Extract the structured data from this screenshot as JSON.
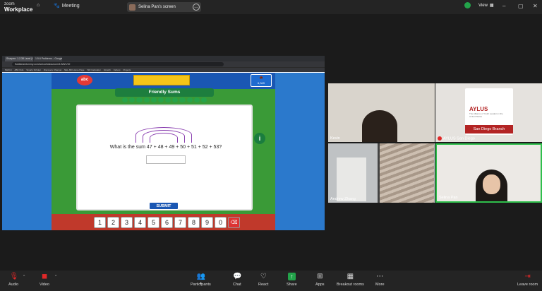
{
  "zoom": {
    "brand_top": "zoom",
    "brand_bottom": "Workplace",
    "meeting_label": "Meeting",
    "screen_share_label": "Selina Pan's screen",
    "view_label": "View",
    "colors": {
      "accent_green": "#23a34a",
      "mic_red": "#e02828",
      "bar": "#242424"
    }
  },
  "browser": {
    "tabs": [
      "Sharpen: 1.2.38 Level | K-Sharpen",
      "1.5.6 Problems – Google Docs"
    ],
    "url": "fluidsteamtommy.com/school/classroom/1/3/6/1/10",
    "bookmarks": [
      "NHICH",
      "ABC Kids",
      "Smarty Scholar",
      "Discovery Channel",
      "SEL-ISD Home Page",
      "ISD Calculator",
      "Scratch",
      "Kahoot",
      "Projects"
    ]
  },
  "game": {
    "logo": "abc",
    "title": "Friendly Sums",
    "acorn_count": "6,349",
    "question": "What is the sum 47 + 48 + 49 + 50 + 51 + 52 + 53?",
    "answer_value": "",
    "submit_label": "SUBMIT",
    "info_glyph": "i",
    "keypad": [
      "1",
      "2",
      "3",
      "4",
      "5",
      "6",
      "7",
      "8",
      "9",
      "0"
    ],
    "delete_glyph": "⌫"
  },
  "participants": [
    {
      "name": "Kevin"
    },
    {
      "name": "AYLUS San Diego",
      "card_title": "AYLUS",
      "card_sub": "The Alliance of Youth Leaders in the United States",
      "card_band": "San Diego Branch"
    },
    {
      "name": "Andrew Zhang"
    },
    {
      "name": "Selina Pan"
    }
  ],
  "toolbar": {
    "audio": "Audio",
    "video": "Video",
    "participants": "Participants",
    "participants_count": "4",
    "chat": "Chat",
    "react": "React",
    "share": "Share",
    "apps": "Apps",
    "breakout": "Breakout rooms",
    "more": "More",
    "leave": "Leave room"
  }
}
